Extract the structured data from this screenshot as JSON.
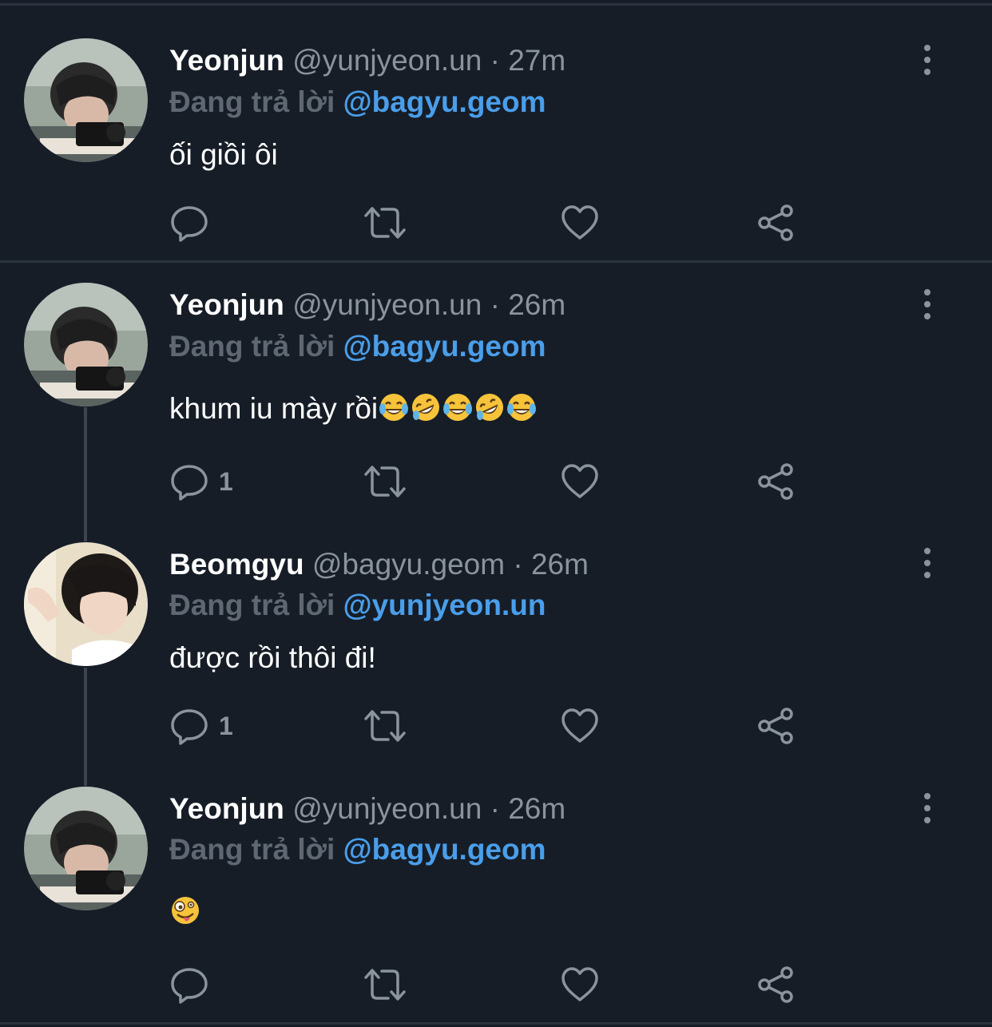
{
  "colors": {
    "background": "#161d27",
    "divider": "#2b333e",
    "name": "#ffffff",
    "handle": "#8b939d",
    "reply_prefix": "#5f6872",
    "mention": "#4a9eea",
    "icon": "#8b939d"
  },
  "tweets": [
    {
      "name": "Yeonjun",
      "handle": "@yunjyeon.un",
      "separator": "·",
      "time": "27m",
      "reply_prefix": "Đang trả lời",
      "reply_to": "@bagyu.geom",
      "text": "ối giồi ôi",
      "emojis": [],
      "reply_count": "",
      "avatar": "avatar-yeonjun"
    },
    {
      "name": "Yeonjun",
      "handle": "@yunjyeon.un",
      "separator": "·",
      "time": "26m",
      "reply_prefix": "Đang trả lời",
      "reply_to": "@bagyu.geom",
      "text": "khum iu mày rồi",
      "emojis": [
        "laughing-tears-emoji",
        "rofl-emoji",
        "laughing-tears-emoji",
        "rofl-emoji",
        "laughing-tears-emoji"
      ],
      "reply_count": "1",
      "avatar": "avatar-yeonjun"
    },
    {
      "name": "Beomgyu",
      "handle": "@bagyu.geom",
      "separator": "·",
      "time": "26m",
      "reply_prefix": "Đang trả lời",
      "reply_to": "@yunjyeon.un",
      "text": "được rồi thôi đi!",
      "emojis": [],
      "reply_count": "1",
      "avatar": "avatar-beomgyu"
    },
    {
      "name": "Yeonjun",
      "handle": "@yunjyeon.un",
      "separator": "·",
      "time": "26m",
      "reply_prefix": "Đang trả lời",
      "reply_to": "@bagyu.geom",
      "text": "",
      "emojis": [
        "zany-face-emoji"
      ],
      "reply_count": "",
      "avatar": "avatar-yeonjun"
    }
  ],
  "action_icons": [
    "reply-icon",
    "retweet-icon",
    "like-icon",
    "share-icon"
  ],
  "menu_icon": "more-vertical-icon"
}
